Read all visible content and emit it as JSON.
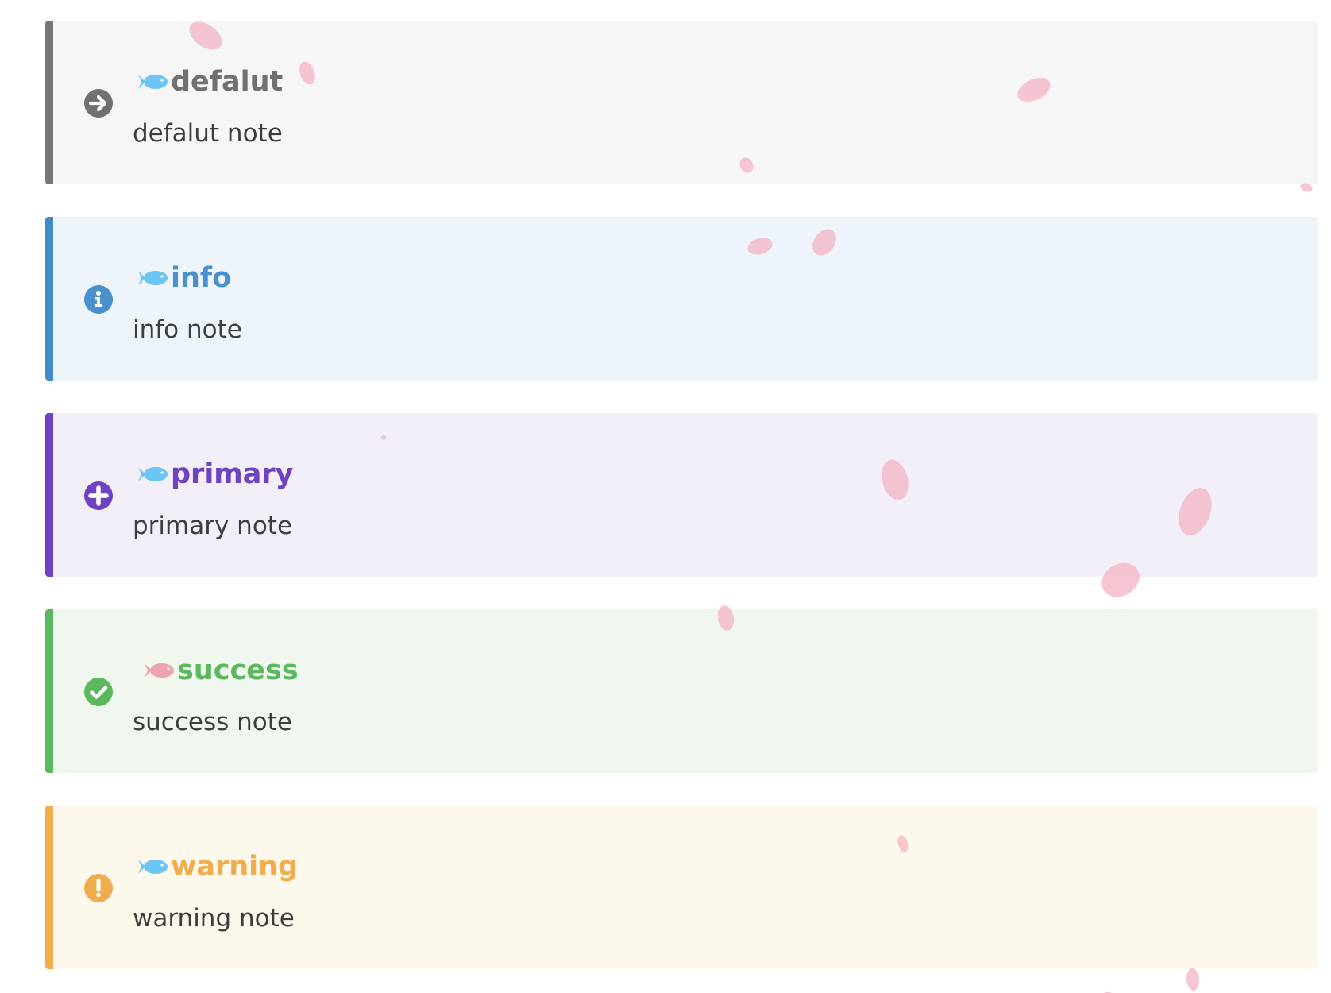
{
  "notes": [
    {
      "title": "defalut",
      "body": "defalut note",
      "icon": "arrow-right-circle-icon",
      "fish_color": "#6cc6f5",
      "accent": "#777777",
      "background": "#f6f6f6",
      "title_color": "#707070"
    },
    {
      "title": "info",
      "body": "info note",
      "icon": "info-circle-icon",
      "fish_color": "#6cc6f5",
      "accent": "#428bca",
      "background": "#eef5fa",
      "title_color": "#4a90cc"
    },
    {
      "title": "primary",
      "body": "primary note",
      "icon": "plus-circle-icon",
      "fish_color": "#6cc6f5",
      "accent": "#6f42c1",
      "background": "#f3eff9",
      "title_color": "#6f42c1"
    },
    {
      "title": "success",
      "body": "success note",
      "icon": "check-circle-icon",
      "fish_color": "#eda3b4",
      "accent": "#5cb85c",
      "background": "#f0f7ef",
      "title_color": "#5cb85c"
    },
    {
      "title": "warning",
      "body": "warning note",
      "icon": "exclamation-circle-icon",
      "fish_color": "#6cc6f5",
      "accent": "#f0ad4e",
      "background": "#fcf8ec",
      "title_color": "#f0ad4e"
    }
  ],
  "decoration": {
    "petal_color": "#f4b6c6"
  }
}
